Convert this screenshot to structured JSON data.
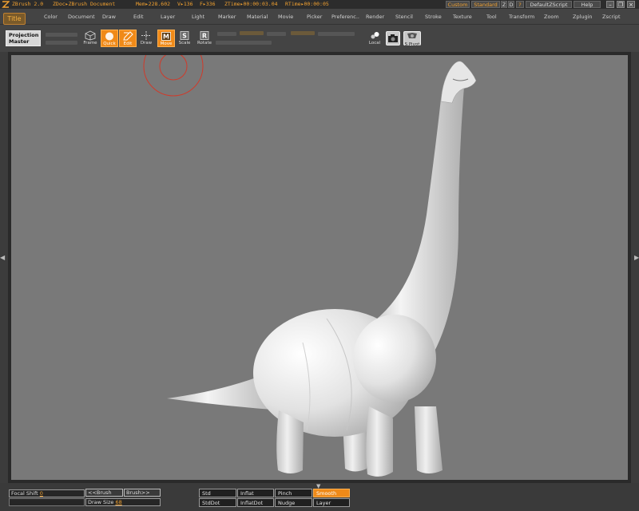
{
  "titlebar": {
    "app": "ZBrush 2.0",
    "doc": "ZDoc▸ZBrush Document",
    "mem": "Mem▸228.602",
    "verts": "V▸136",
    "faces": "F▸336",
    "ztime": "ZTime▸00:00:03.04",
    "rtime": "RTime▸00:00:05",
    "custom": "Custom",
    "standard": "Standard",
    "z": "Z",
    "d": "D",
    "q": "?",
    "defaultzscript": "DefaultZScript",
    "help": "Help",
    "minimize": "–",
    "restore": "❐",
    "close": "×"
  },
  "menubar": {
    "title": "Title",
    "items": [
      "Color",
      "Document",
      "Draw",
      "Edit",
      "Layer",
      "Light",
      "Marker",
      "Material",
      "Movie",
      "Picker",
      "Preferenc..",
      "Render",
      "Stencil",
      "Stroke",
      "Texture",
      "Tool",
      "Transform",
      "Zoom",
      "Zplugin",
      "Zscript"
    ]
  },
  "toolbar": {
    "projection_master": [
      "Projection",
      "Master"
    ],
    "frame": "Frame",
    "quick": "Quick",
    "edit": "Edit",
    "draw": "Draw",
    "move": "Move",
    "scale": "Scale",
    "rotate": "Rotate",
    "local": "Local",
    "spivot": "S.Pivot"
  },
  "bottom": {
    "focal_shift_label": "Focal Shift",
    "focal_shift_value": "0",
    "prev_brush": "<<Brush",
    "next_brush": "Brush>>",
    "draw_size_label": "Draw Size",
    "draw_size_value": "68",
    "strokes": [
      [
        "Std",
        "Inflat",
        "Pinch",
        "Smooth"
      ],
      [
        "StdDot",
        "InflatDot",
        "Nudge",
        "Layer"
      ]
    ]
  },
  "colors": {
    "accent": "#f08a18",
    "viewport": "#797979",
    "brush_ring": "#d03a2a"
  }
}
